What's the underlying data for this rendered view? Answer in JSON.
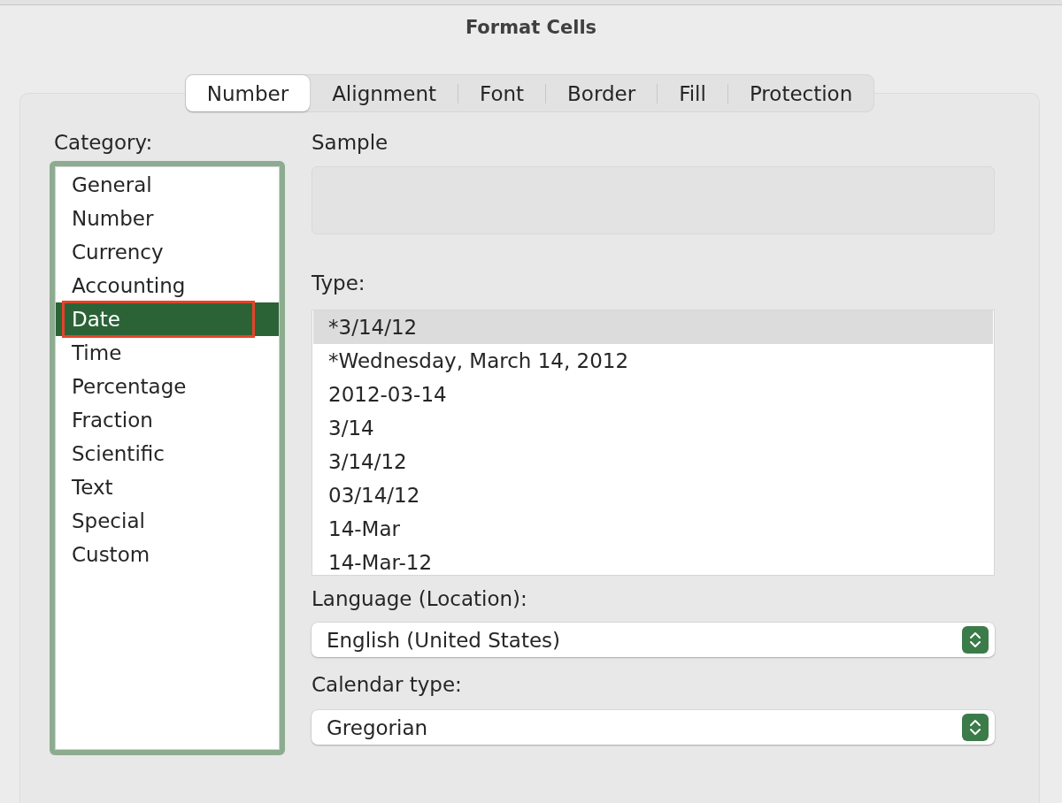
{
  "window": {
    "title": "Format Cells"
  },
  "tabs": [
    {
      "label": "Number",
      "selected": true
    },
    {
      "label": "Alignment",
      "selected": false
    },
    {
      "label": "Font",
      "selected": false
    },
    {
      "label": "Border",
      "selected": false
    },
    {
      "label": "Fill",
      "selected": false
    },
    {
      "label": "Protection",
      "selected": false
    }
  ],
  "category": {
    "label": "Category:",
    "items": [
      {
        "label": "General",
        "selected": false,
        "highlighted": false
      },
      {
        "label": "Number",
        "selected": false,
        "highlighted": false
      },
      {
        "label": "Currency",
        "selected": false,
        "highlighted": false
      },
      {
        "label": "Accounting",
        "selected": false,
        "highlighted": false
      },
      {
        "label": "Date",
        "selected": true,
        "highlighted": true
      },
      {
        "label": "Time",
        "selected": false,
        "highlighted": false
      },
      {
        "label": "Percentage",
        "selected": false,
        "highlighted": false
      },
      {
        "label": "Fraction",
        "selected": false,
        "highlighted": false
      },
      {
        "label": "Scientific",
        "selected": false,
        "highlighted": false
      },
      {
        "label": "Text",
        "selected": false,
        "highlighted": false
      },
      {
        "label": "Special",
        "selected": false,
        "highlighted": false
      },
      {
        "label": "Custom",
        "selected": false,
        "highlighted": false
      }
    ]
  },
  "sample": {
    "label": "Sample"
  },
  "type": {
    "label": "Type:",
    "items": [
      {
        "label": "*3/14/12",
        "selected": true
      },
      {
        "label": "*Wednesday, March 14, 2012",
        "selected": false
      },
      {
        "label": "2012-03-14",
        "selected": false
      },
      {
        "label": "3/14",
        "selected": false
      },
      {
        "label": "3/14/12",
        "selected": false
      },
      {
        "label": "03/14/12",
        "selected": false
      },
      {
        "label": "14-Mar",
        "selected": false
      },
      {
        "label": "14-Mar-12",
        "selected": false
      }
    ]
  },
  "language": {
    "label": "Language (Location):",
    "value": "English (United States)"
  },
  "calendar_type": {
    "label": "Calendar type:",
    "value": "Gregorian"
  }
}
